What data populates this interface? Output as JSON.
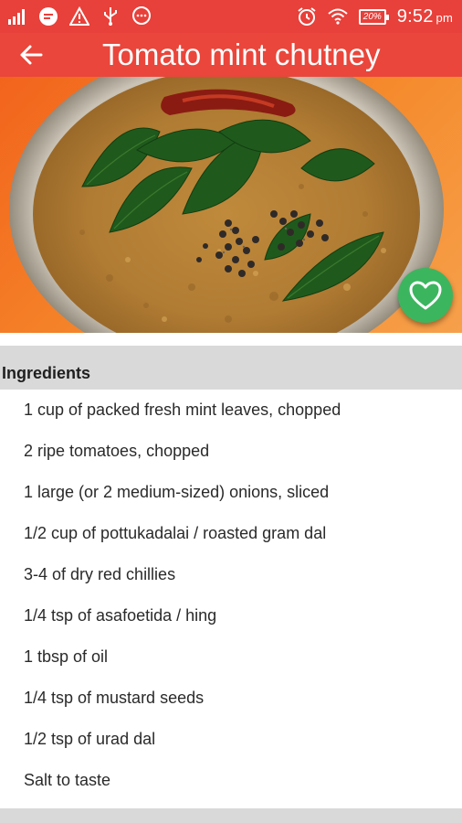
{
  "status_bar": {
    "left_icons": [
      "signal-icon",
      "message-icon",
      "warning-icon",
      "usb-icon",
      "chat-icon"
    ],
    "right_icons": [
      "alarm-icon",
      "wifi-icon"
    ],
    "battery": "20%",
    "time": "9:52",
    "ampm": "pm"
  },
  "app_bar": {
    "back_icon": "arrow-left-icon",
    "title": "Tomato mint chutney",
    "color": "#ea463b"
  },
  "hero": {
    "description_icon": "chutney-photo",
    "favorite_icon": "heart-icon",
    "favorite_color": "#3cb55f"
  },
  "ingredients": {
    "heading": "Ingredients",
    "items": [
      "1 cup of packed fresh mint leaves, chopped",
      "2 ripe tomatoes, chopped",
      "1 large (or 2 medium-sized) onions, sliced",
      "1/2 cup of pottukadalai / roasted gram dal",
      "3-4 of dry red chillies",
      "1/4 tsp of asafoetida / hing",
      "1 tbsp of oil",
      "1/4 tsp of mustard seeds",
      "1/2 tsp of urad dal",
      "Salt to taste"
    ]
  }
}
